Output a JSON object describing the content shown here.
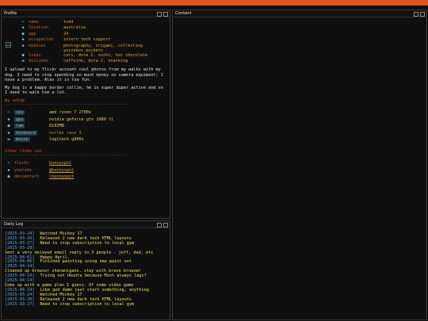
{
  "profile": {
    "title": "Profile",
    "fields": [
      {
        "icon": "✂",
        "key": "name",
        "value": "todd"
      },
      {
        "icon": "◆",
        "key": "location",
        "value": "australia"
      },
      {
        "icon": "●",
        "key": "age",
        "value": "24"
      },
      {
        "icon": "◆",
        "key": "occupation",
        "value": "intern tech support"
      },
      {
        "icon": "◆",
        "key": "hobbies",
        "value": "photography, origami, collecting yuzzebox puckets"
      },
      {
        "icon": "●",
        "key": "likes",
        "value": "cats, dota 2, sushi, hot chocolate"
      },
      {
        "icon": "▬",
        "key": "dislikes",
        "value": "caffeine, dota 2, snacking"
      }
    ],
    "bio1": "I upload to my flickr account cool photos from my walks with my dog. I need to stop spending so much money on camera equiment; I have a problem. Alas it is too fun.",
    "bio2": "My dog is a happy border collie, he is super duper active and so I need to walk him a lot.",
    "setup_title": "my setup",
    "rule": "--------------------------------------------------",
    "setup": [
      {
        "icon": "✂",
        "key": "cpu",
        "value": "amd ryzen 7 2700x"
      },
      {
        "icon": "◆",
        "key": "gpu",
        "value": "nvidia geforce gtx 1080 ti"
      },
      {
        "icon": "●",
        "key": "ram",
        "value": "8192MB"
      },
      {
        "icon": "◆",
        "key": "keyboard",
        "value": "vortex race 3"
      },
      {
        "icon": "▬",
        "key": "mouse",
        "value": "logitech g900s"
      }
    ],
    "links_title": "other links out",
    "links": [
      {
        "icon": "✂",
        "key": "flickr",
        "value": "bunnyspot"
      },
      {
        "icon": "◆",
        "key": "youtube",
        "value": "@bunnyspot"
      },
      {
        "icon": "●",
        "key": "deviantart",
        "value": "~bunnyspot"
      }
    ]
  },
  "content": {
    "title": "Content"
  },
  "log": {
    "title": "Daily Log",
    "entries": [
      {
        "date": "[2025-03-24]",
        "text": "Watched Mickey 17"
      },
      {
        "date": "[2025-03-26]",
        "text": "Released 2 new dark tech HTML layouts"
      },
      {
        "date": "[2025-03-27]",
        "text": "Need to stop subscription to local gym"
      },
      {
        "date": "[2025-03-28]",
        "text": ""
      },
      {
        "date": "",
        "text": "Sent a very delayed email reply to 3 people - jeff, dad, etc"
      },
      {
        "date": "[2025-04-01]",
        "text": "Happy April."
      },
      {
        "date": "[2025-04-06]",
        "text": "Finished painting using new paint set"
      },
      {
        "date": "[2025-04-14]",
        "text": ""
      },
      {
        "date": "",
        "text": "Cleaned up browser shenanigans. stay with brave browser"
      },
      {
        "date": "[2025-04-14]",
        "text": "Trying out Ubuntu because Mint always lags?"
      },
      {
        "date": "[2025-04-14]",
        "text": ""
      },
      {
        "date": "",
        "text": "Come up with a game plan I guess. Of some video game"
      },
      {
        "date": "[2025-04-14]",
        "text": "Like god damn just start something, anything"
      },
      {
        "date": "[2025-03-24]",
        "text": "Watched Mickey 17"
      },
      {
        "date": "[2025-03-26]",
        "text": "Released 2 new dark tech HTML layouts"
      },
      {
        "date": "[2025-03-27]",
        "text": "Need to stop subscription to local gym"
      }
    ]
  },
  "colors": {
    "accent": "#e0531f",
    "date": "#5fa7d8",
    "log_text": "#e8e06a",
    "key": "#c06a33",
    "value": "#d9a53a"
  }
}
